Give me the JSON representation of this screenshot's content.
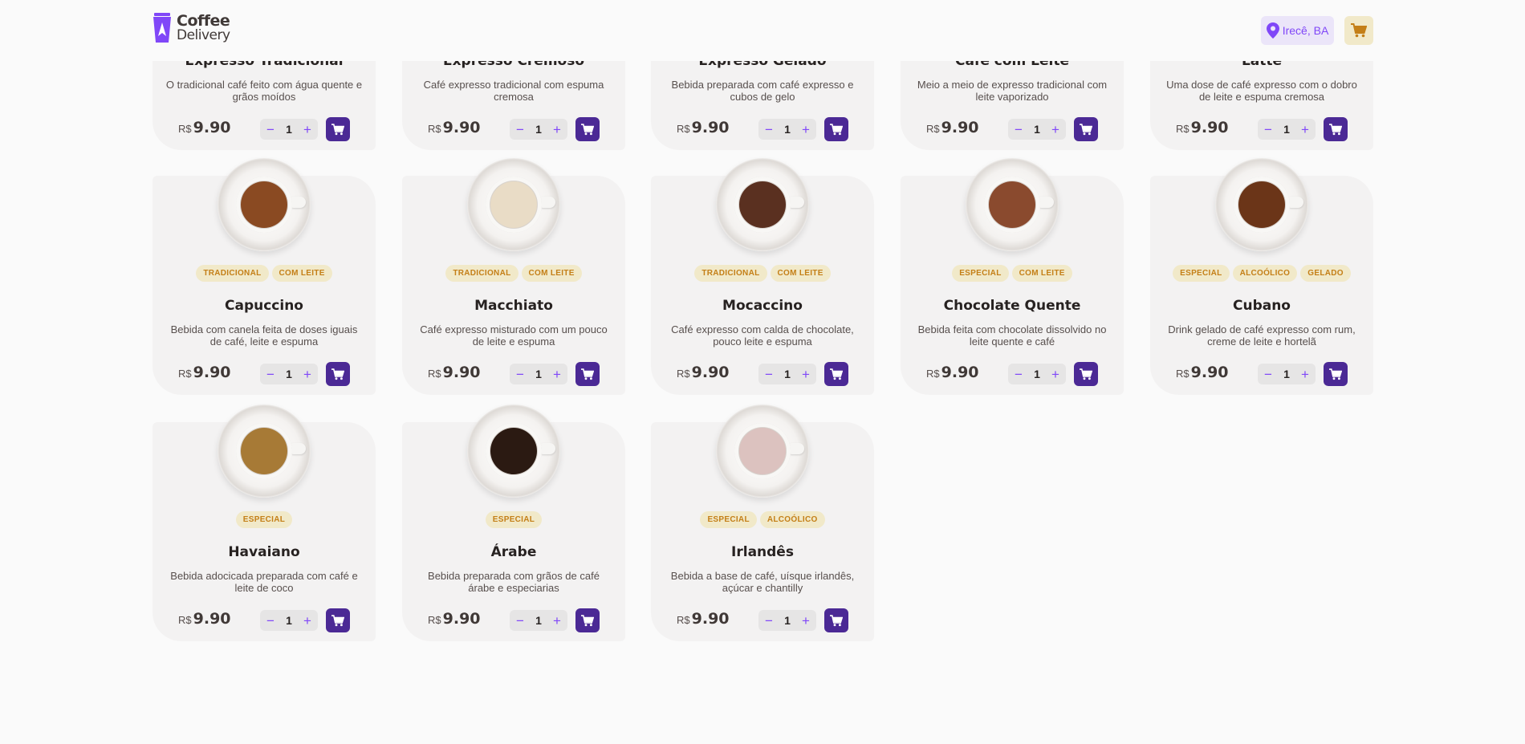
{
  "header": {
    "logo_line1": "Coffee",
    "logo_line2": "Delivery",
    "location": "Irecê, BA"
  },
  "currency": "R$",
  "products": [
    {
      "name": "Expresso Tradicional",
      "desc": "O tradicional café feito com água quente e grãos moídos",
      "price": "9.90",
      "qty": "1",
      "tags": []
    },
    {
      "name": "Expresso Cremoso",
      "desc": "Café expresso tradicional com espuma cremosa",
      "price": "9.90",
      "qty": "1",
      "tags": []
    },
    {
      "name": "Expresso Gelado",
      "desc": "Bebida preparada com café expresso e cubos de gelo",
      "price": "9.90",
      "qty": "1",
      "tags": []
    },
    {
      "name": "Café com Leite",
      "desc": "Meio a meio de expresso tradicional com leite vaporizado",
      "price": "9.90",
      "qty": "1",
      "tags": []
    },
    {
      "name": "Latte",
      "desc": "Uma dose de café expresso com o dobro de leite e espuma cremosa",
      "price": "9.90",
      "qty": "1",
      "tags": []
    },
    {
      "name": "Capuccino",
      "desc": "Bebida com canela feita de doses iguais de café, leite e espuma",
      "price": "9.90",
      "qty": "1",
      "tags": [
        "Tradicional",
        "Com leite"
      ],
      "coffee": "#8a4a22"
    },
    {
      "name": "Macchiato",
      "desc": "Café expresso misturado com um pouco de leite e espuma",
      "price": "9.90",
      "qty": "1",
      "tags": [
        "Tradicional",
        "Com leite"
      ],
      "coffee": "#e9dcc6"
    },
    {
      "name": "Mocaccino",
      "desc": "Café expresso com calda de chocolate, pouco leite e espuma",
      "price": "9.90",
      "qty": "1",
      "tags": [
        "Tradicional",
        "Com leite"
      ],
      "coffee": "#5a3020"
    },
    {
      "name": "Chocolate Quente",
      "desc": "Bebida feita com chocolate dissolvido no leite quente e café",
      "price": "9.90",
      "qty": "1",
      "tags": [
        "Especial",
        "Com leite"
      ],
      "coffee": "#8a4a2e"
    },
    {
      "name": "Cubano",
      "desc": "Drink gelado de café expresso com rum, creme de leite e hortelã",
      "price": "9.90",
      "qty": "1",
      "tags": [
        "Especial",
        "Alcoólico",
        "Gelado"
      ],
      "coffee": "#6b3518"
    },
    {
      "name": "Havaiano",
      "desc": "Bebida adocicada preparada com café e leite de coco",
      "price": "9.90",
      "qty": "1",
      "tags": [
        "Especial"
      ],
      "coffee": "#a77a36"
    },
    {
      "name": "Árabe",
      "desc": "Bebida preparada com grãos de café árabe e especiarias",
      "price": "9.90",
      "qty": "1",
      "tags": [
        "Especial"
      ],
      "coffee": "#2b1a12"
    },
    {
      "name": "Irlandês",
      "desc": "Bebida a base de café, uísque irlandês, açúcar e chantilly",
      "price": "9.90",
      "qty": "1",
      "tags": [
        "Especial",
        "Alcoólico"
      ],
      "coffee": "#dcc2bf"
    }
  ],
  "icons": {
    "logo": "coffee-cup-icon",
    "location": "map-pin-icon",
    "cart": "shopping-cart-icon",
    "minus": "minus-icon",
    "plus": "plus-icon"
  },
  "colors": {
    "purple_dark": "#4b2995",
    "purple": "#8047f8",
    "purple_light": "#ebe5f9",
    "yellow_dark": "#c47f17",
    "yellow": "#dbac2c",
    "yellow_light": "#f1e9c9",
    "card_bg": "#f3f2f2"
  }
}
